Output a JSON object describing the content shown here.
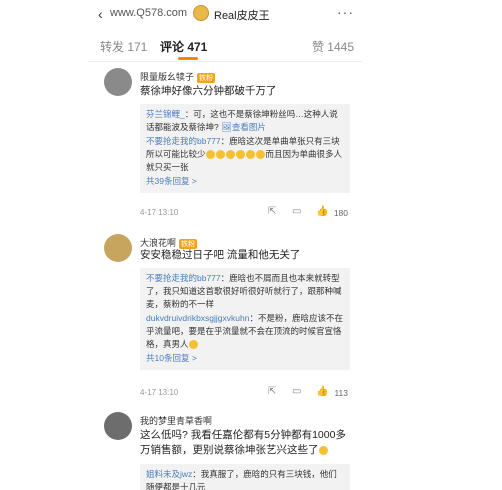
{
  "header": {
    "back_icon": "‹",
    "watermark": "www.Q578.com",
    "title": "Real皮皮王",
    "more_icon": "···"
  },
  "tabs": {
    "repost": "转发 171",
    "comments": "评论 471",
    "likes": "赞 1445"
  },
  "comments": [
    {
      "user": "限量版幺犊子",
      "badge": "铁粉",
      "text": "蔡徐坤好像六分钟都破千万了",
      "replies": [
        {
          "name": "芬兰锦鲤_",
          "text": "：可，这也不是蔡徐坤粉丝吗…这种人说话都能波及蔡徐坤?",
          "link": "查看图片"
        },
        {
          "name": "不要抢走我的bb777",
          "text": "：鹿晗这次是单曲单张只有三块所以可能比较少",
          "tail": "而且因为单曲很多人就只买一张"
        }
      ],
      "more": "共39条回复 >",
      "time": "4-17 13:10",
      "likes": "180"
    },
    {
      "user": "大浪花啊",
      "badge": "铁粉",
      "text": "安安稳稳过日子吧 流量和他无关了",
      "replies": [
        {
          "name": "不要抢走我的bb777",
          "text": "：鹿晗也不屑而且也本来就转型了，我只知道这首歌很好听很好听就行了，跟那种喊麦，蔡粉的不一样"
        },
        {
          "name": "dukvdruivdrikbxsgjjgxvkuhn",
          "text": "：不是粉，鹿晗应该不在乎流量吧，要是在乎流量就不会在顶流的时候官宣恪格，真男人"
        }
      ],
      "more": "共10条回复 >",
      "time": "4-17 13:10",
      "likes": "113"
    },
    {
      "user": "我的梦里青草香啊",
      "badge": "",
      "text": "这么低吗? 我看任嘉伦都有5分钟都有1000多万销售额，更别说蔡徐坤张艺兴这些了",
      "replies": [
        {
          "name": "姐料未及jwz",
          "text": "：我真服了，鹿晗的只有三块钱，他们随便都是十几元"
        }
      ]
    }
  ]
}
